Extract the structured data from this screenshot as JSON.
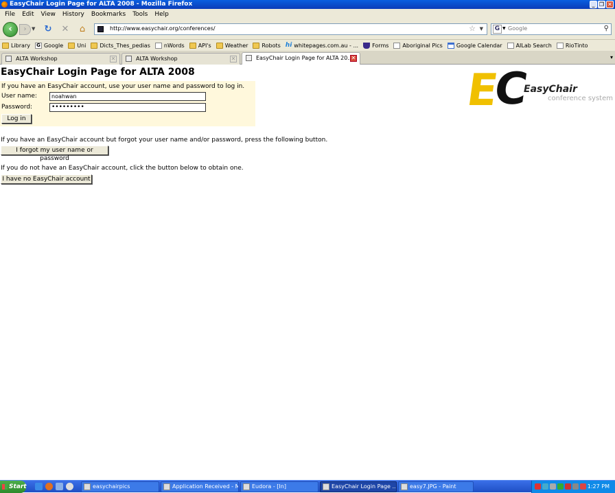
{
  "window": {
    "title": "EasyChair Login Page for ALTA 2008 - Mozilla Firefox"
  },
  "menu": [
    {
      "label": "File"
    },
    {
      "label": "Edit"
    },
    {
      "label": "View"
    },
    {
      "label": "History"
    },
    {
      "label": "Bookmarks"
    },
    {
      "label": "Tools"
    },
    {
      "label": "Help"
    }
  ],
  "nav": {
    "url": "http://www.easychair.org/conferences/",
    "search_placeholder": "Google"
  },
  "bookmarks": [
    {
      "label": "Library",
      "icon": "folder-icon"
    },
    {
      "label": "Google",
      "icon": "google-icon"
    },
    {
      "label": "Uni",
      "icon": "folder-icon"
    },
    {
      "label": "Dicts_Thes_pedias",
      "icon": "folder-icon"
    },
    {
      "label": "nWords",
      "icon": "page-icon"
    },
    {
      "label": "API's",
      "icon": "folder-icon"
    },
    {
      "label": "Weather",
      "icon": "folder-icon"
    },
    {
      "label": "Robots",
      "icon": "folder-icon"
    },
    {
      "label": "whitepages.com.au - ...",
      "icon": "hi-icon"
    },
    {
      "label": "Forms",
      "icon": "shield-icon"
    },
    {
      "label": "Aboriginal Pics",
      "icon": "page-icon"
    },
    {
      "label": "Google Calendar",
      "icon": "calendar-icon"
    },
    {
      "label": "AILab Search",
      "icon": "page-icon"
    },
    {
      "label": "RioTinto",
      "icon": "page-icon"
    }
  ],
  "tabs": [
    {
      "label": "ALTA Workshop"
    },
    {
      "label": "ALTA Workshop"
    },
    {
      "label": "EasyChair Login Page for ALTA 20..."
    }
  ],
  "page": {
    "heading": "EasyChair Login Page for ALTA 2008",
    "intro": "If you have an EasyChair account, use your user name and password to log in.",
    "username_label": "User name:",
    "username_value": "noahwan",
    "password_label": "Password:",
    "password_value": "•••••••••",
    "login_button": "Log in",
    "forgot_text": "If you have an EasyChair account but forgot your user name and/or password, press the following button.",
    "forgot_button": "I forgot my user name or password",
    "noaccount_text": "If you do not have an EasyChair account, click the button below to obtain one.",
    "noaccount_button": "I have no EasyChair account",
    "logo": {
      "letters_e": "E",
      "letters_c": "C",
      "name": "EasyChair",
      "tagline": "conference system"
    }
  },
  "taskbar": {
    "start": "Start",
    "tasks": [
      {
        "label": "easychairpics"
      },
      {
        "label": "Application Received - M..."
      },
      {
        "label": "Eudora - [In]"
      },
      {
        "label": "EasyChair Login Page ..."
      },
      {
        "label": "easy7.JPG - Paint"
      }
    ],
    "clock": "1:27 PM"
  }
}
